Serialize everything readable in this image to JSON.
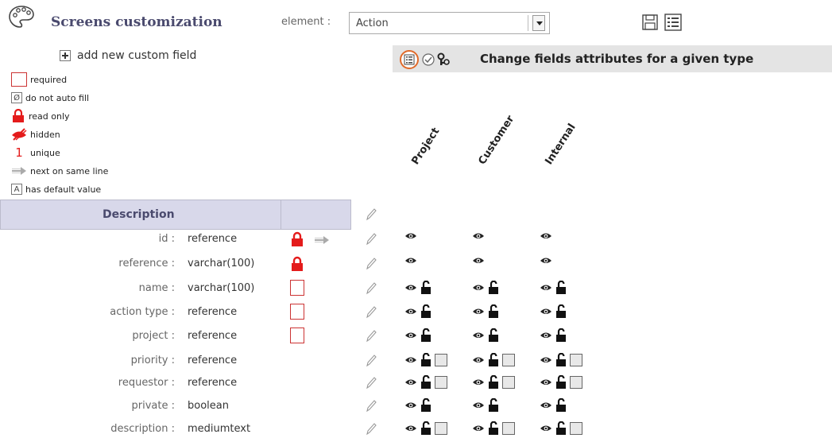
{
  "header": {
    "title": "Screens customization",
    "element_label": "element :",
    "element_value": "Action"
  },
  "add_field": {
    "label": "add new custom field"
  },
  "attr_bar": {
    "title": "Change fields attributes for a given type"
  },
  "legend": {
    "required": "required",
    "no_autofill": "do not auto fill",
    "no_autofill_symbol": "Ø",
    "read_only": "read only",
    "hidden": "hidden",
    "unique": "unique",
    "unique_symbol": "1",
    "next_same_line": "next on same line",
    "default_value": "has default value",
    "default_value_symbol": "A"
  },
  "columns": [
    "Project",
    "Customer",
    "Internal"
  ],
  "table": {
    "header": "Description"
  },
  "fields": [
    {
      "name": "id :",
      "type": "reference",
      "flags": [
        "readonly",
        "next"
      ],
      "attrs": [
        "eye"
      ]
    },
    {
      "name": "reference :",
      "type": "varchar(100)",
      "flags": [
        "readonly"
      ],
      "attrs": [
        "eye"
      ]
    },
    {
      "name": "name :",
      "type": "varchar(100)",
      "flags": [
        "required"
      ],
      "attrs": [
        "eye",
        "lock"
      ]
    },
    {
      "name": "action type :",
      "type": "reference",
      "flags": [
        "required"
      ],
      "attrs": [
        "eye",
        "lock"
      ]
    },
    {
      "name": "project :",
      "type": "reference",
      "flags": [
        "required"
      ],
      "attrs": [
        "eye",
        "lock"
      ]
    },
    {
      "name": "priority :",
      "type": "reference",
      "flags": [],
      "attrs": [
        "eye",
        "lock",
        "box"
      ]
    },
    {
      "name": "requestor :",
      "type": "reference",
      "flags": [],
      "attrs": [
        "eye",
        "lock",
        "box"
      ]
    },
    {
      "name": "private :",
      "type": "boolean",
      "flags": [],
      "attrs": [
        "eye",
        "lock"
      ]
    },
    {
      "name": "description :",
      "type": "mediumtext",
      "flags": [],
      "attrs": [
        "eye",
        "lock",
        "box"
      ]
    }
  ],
  "colors": {
    "accent": "#4a4a6e",
    "red": "#e41b1b",
    "header_bg": "#d8d8ea",
    "bar_bg": "#e4e4e4"
  }
}
